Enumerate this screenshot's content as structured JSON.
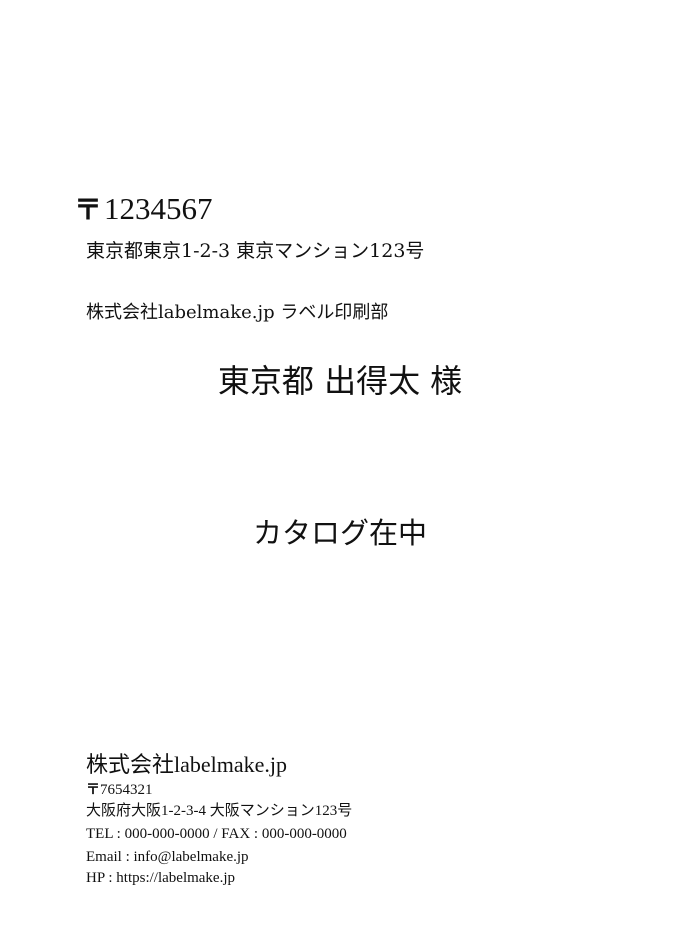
{
  "recipient": {
    "postal_mark": "〒",
    "postal_code": "1234567",
    "address": "東京都東京1-2-3 東京マンション123号",
    "company": "株式会社labelmake.jp ラベル印刷部",
    "name": "東京都 出得太",
    "honorific": "様"
  },
  "notice": "カタログ在中",
  "sender": {
    "company": "株式会社labelmake.jp",
    "postal_mark": "〒",
    "postal_code": "7654321",
    "address": "大阪府大阪1-2-3-4 大阪マンション123号",
    "tel_fax": "TEL : 000-000-0000 / FAX : 000-000-0000",
    "email": "Email : info@labelmake.jp",
    "hp": "HP : https://labelmake.jp"
  }
}
